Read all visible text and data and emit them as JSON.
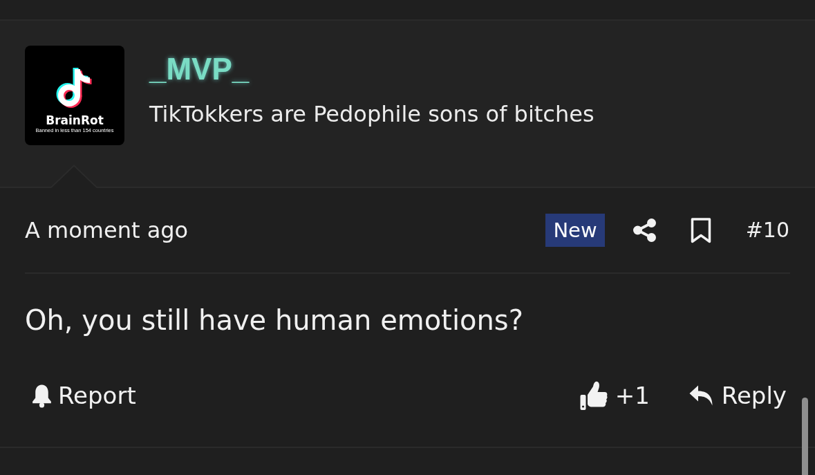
{
  "post": {
    "author": {
      "avatar": {
        "logo_text": "BrainRot",
        "tagline": "Banned in less than 154 countries"
      },
      "name": "_MVP_",
      "title": "TikTokkers are Pedophile sons of bitches"
    },
    "meta": {
      "time": "A moment ago",
      "badge": "New",
      "bookmarked": false,
      "number": "#10"
    },
    "body": "Oh, you still have human emotions?",
    "actions": [
      {
        "kind": "report",
        "label": "Report"
      },
      {
        "kind": "like",
        "label": "+1"
      },
      {
        "kind": "reply",
        "label": "Reply"
      }
    ]
  }
}
